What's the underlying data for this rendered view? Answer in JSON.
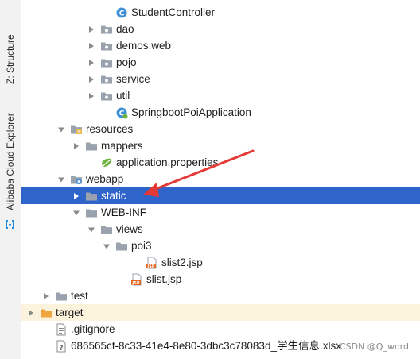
{
  "sidebar": {
    "structure_label": "Z: Structure",
    "alibaba_label": "Alibaba Cloud Explorer"
  },
  "tree": [
    {
      "label": "StudentController",
      "depth": 5,
      "arrow": "none",
      "icon": "class-icon"
    },
    {
      "label": "dao",
      "depth": 4,
      "arrow": "right",
      "icon": "package-icon"
    },
    {
      "label": "demos.web",
      "depth": 4,
      "arrow": "right",
      "icon": "package-icon"
    },
    {
      "label": "pojo",
      "depth": 4,
      "arrow": "right",
      "icon": "package-icon"
    },
    {
      "label": "service",
      "depth": 4,
      "arrow": "right",
      "icon": "package-icon"
    },
    {
      "label": "util",
      "depth": 4,
      "arrow": "right",
      "icon": "package-icon"
    },
    {
      "label": "SpringbootPoiApplication",
      "depth": 5,
      "arrow": "none",
      "icon": "spring-class-icon"
    },
    {
      "label": "resources",
      "depth": 2,
      "arrow": "down",
      "icon": "resources-folder-icon"
    },
    {
      "label": "mappers",
      "depth": 3,
      "arrow": "right",
      "icon": "folder-icon"
    },
    {
      "label": "application.properties",
      "depth": 4,
      "arrow": "none",
      "icon": "properties-file-icon"
    },
    {
      "label": "webapp",
      "depth": 2,
      "arrow": "down",
      "icon": "web-folder-icon"
    },
    {
      "label": "static",
      "depth": 3,
      "arrow": "right",
      "icon": "folder-icon",
      "selected": true
    },
    {
      "label": "WEB-INF",
      "depth": 3,
      "arrow": "down",
      "icon": "folder-icon"
    },
    {
      "label": "views",
      "depth": 4,
      "arrow": "down",
      "icon": "folder-icon"
    },
    {
      "label": "poi3",
      "depth": 5,
      "arrow": "down",
      "icon": "folder-icon"
    },
    {
      "label": "slist2.jsp",
      "depth": 7,
      "arrow": "none",
      "icon": "jsp-file-icon"
    },
    {
      "label": "slist.jsp",
      "depth": 6,
      "arrow": "none",
      "icon": "jsp-file-icon"
    },
    {
      "label": "test",
      "depth": 1,
      "arrow": "right",
      "icon": "folder-icon"
    },
    {
      "label": "target",
      "depth": 0,
      "arrow": "right",
      "icon": "excluded-folder-icon",
      "excluded": true
    },
    {
      "label": ".gitignore",
      "depth": 1,
      "arrow": "none",
      "icon": "text-file-icon"
    },
    {
      "label": "686565cf-8c33-41e4-8e80-3dbc3c78083d_学生信息.xlsx",
      "depth": 1,
      "arrow": "none",
      "icon": "unknown-file-icon"
    }
  ],
  "watermark": "CSDN @Q_word",
  "colors": {
    "selection": "#2f65ca",
    "annotation_arrow": "#e53935",
    "folder": "#9aa3ad",
    "excluded_folder": "#f0a640"
  }
}
